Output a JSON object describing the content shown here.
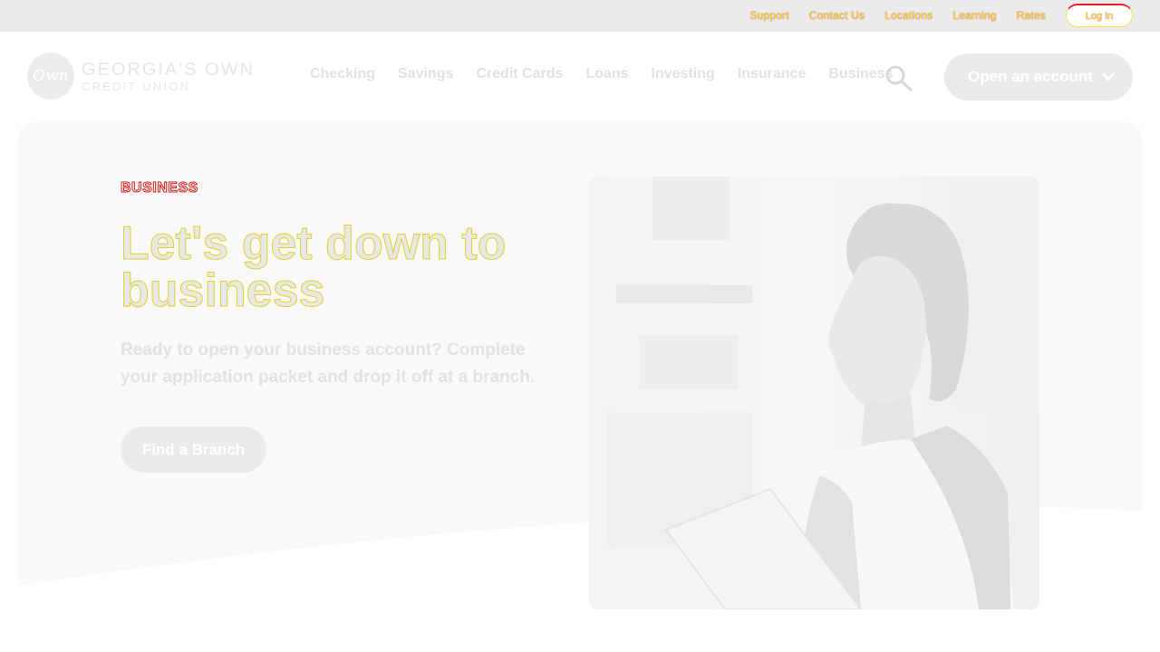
{
  "utility_nav": {
    "links": [
      "Support",
      "Contact Us",
      "Locations",
      "Learning",
      "Rates"
    ],
    "login_label": "Log In"
  },
  "brand": {
    "logo_mark": "Own",
    "name_line1": "GEORGIA'S OWN",
    "name_line2": "CREDIT UNION"
  },
  "main_nav": {
    "items": [
      "Checking",
      "Savings",
      "Credit Cards",
      "Loans",
      "Investing",
      "Insurance",
      "Business"
    ]
  },
  "header_actions": {
    "search_icon": "search-icon",
    "open_account_label": "Open an account",
    "open_account_icon": "chevron-down-icon"
  },
  "hero": {
    "eyebrow": "BUSINESS",
    "headline": "Let's get down to business",
    "subtext": "Ready to open your business account? Complete your application packet and drop it off at a branch.",
    "cta_label": "Find a Branch",
    "image": "businesswoman-holding-folder-photo"
  },
  "colors": {
    "utility_bar_bg": "#ebebeb",
    "hero_bg": "#f9f9f9",
    "button_bg": "#ebebeb",
    "eyebrow_red": "#d01a1a",
    "headline_outline_yellow": "#e3cf2c"
  }
}
